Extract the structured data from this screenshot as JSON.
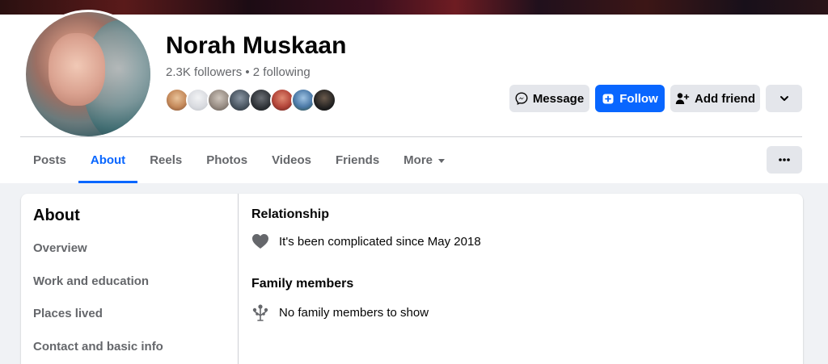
{
  "profile": {
    "name": "Norah Muskaan",
    "stats": "2.3K followers • 2 following"
  },
  "friend_avatars": [
    {
      "color": "#c58a5b"
    },
    {
      "color": "#d8dadf"
    },
    {
      "color": "#9a8f86"
    },
    {
      "color": "#4e5a66"
    },
    {
      "color": "#2f3338"
    },
    {
      "color": "#b4463a"
    },
    {
      "color": "#4c7aa8"
    },
    {
      "color": "#1f1f1f"
    }
  ],
  "actions": {
    "message": "Message",
    "follow": "Follow",
    "add_friend": "Add friend"
  },
  "tabs": [
    {
      "label": "Posts"
    },
    {
      "label": "About"
    },
    {
      "label": "Reels"
    },
    {
      "label": "Photos"
    },
    {
      "label": "Videos"
    },
    {
      "label": "Friends"
    },
    {
      "label": "More"
    }
  ],
  "about": {
    "title": "About",
    "nav": [
      "Overview",
      "Work and education",
      "Places lived",
      "Contact and basic info"
    ],
    "relationship_title": "Relationship",
    "relationship_text": "It's been complicated since May 2018",
    "family_title": "Family members",
    "family_text": "No family members to show"
  },
  "colors": {
    "accent": "#0866ff",
    "muted_text": "#65676b",
    "button_gray": "#e4e6eb"
  }
}
